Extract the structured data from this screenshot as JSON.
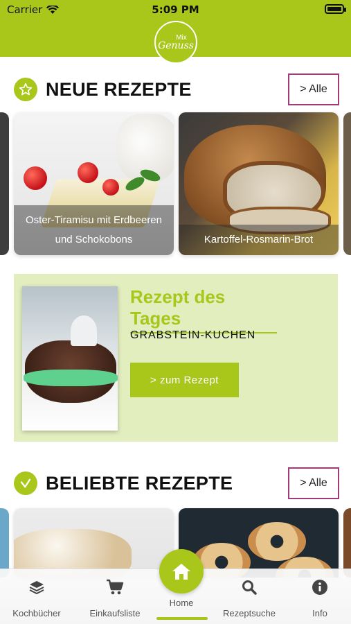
{
  "status_bar": {
    "carrier": "Carrier",
    "time": "5:09 PM"
  },
  "header": {
    "logo_top": "Mix",
    "logo_bottom": "Genuss"
  },
  "neue_rezepte": {
    "title": "NEUE REZEPTE",
    "all_label": "> Alle",
    "cards": [
      {
        "title": "Oster-Tiramisu mit Erdbeeren und Schokobons"
      },
      {
        "title": "Kartoffel-Rosmarin-Brot"
      }
    ]
  },
  "rezept_des_tages": {
    "heading": "Rezept des Tages",
    "recipe_name": "GRABSTEIN-KUCHEN",
    "button_label": "> zum Rezept"
  },
  "beliebte_rezepte": {
    "title": "BELIEBTE REZEPTE",
    "all_label": "> Alle"
  },
  "tabbar": {
    "items": [
      {
        "label": "Kochbücher",
        "icon": "stack-icon"
      },
      {
        "label": "Einkaufsliste",
        "icon": "cart-icon"
      },
      {
        "label": "Home",
        "icon": "home-icon"
      },
      {
        "label": "Rezeptsuche",
        "icon": "search-icon"
      },
      {
        "label": "Info",
        "icon": "info-icon"
      }
    ],
    "active": "Home"
  },
  "colors": {
    "brand_green": "#a9c61b",
    "accent_border": "#a03a78",
    "daily_bg": "#e3eebf"
  }
}
